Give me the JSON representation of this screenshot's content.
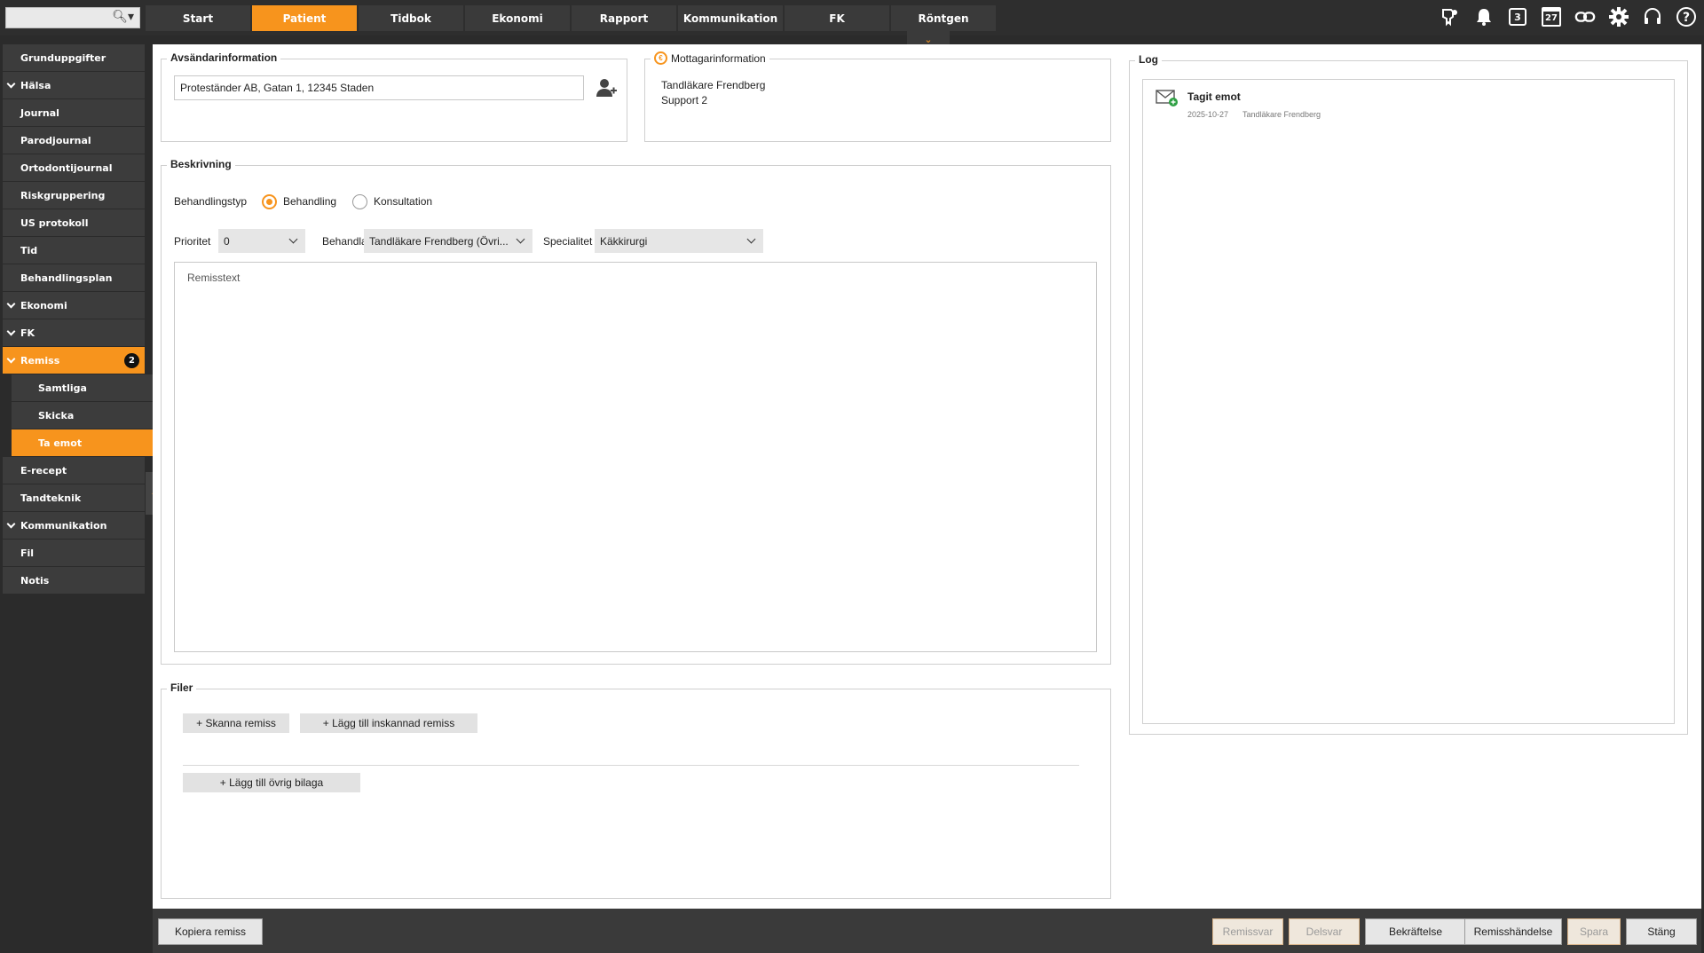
{
  "search": {
    "placeholder": ""
  },
  "tabs": [
    {
      "label": "Start"
    },
    {
      "label": "Patient"
    },
    {
      "label": "Tidbok"
    },
    {
      "label": "Ekonomi"
    },
    {
      "label": "Rapport"
    },
    {
      "label": "Kommunikation"
    },
    {
      "label": "FK"
    },
    {
      "label": "Röntgen"
    }
  ],
  "top_icons": {
    "notification_count": "3",
    "calendar_day": "27",
    "icons": [
      "tooth-book-icon",
      "bell-icon",
      "counter-icon",
      "calendar-icon",
      "link-icon",
      "gear-icon",
      "headset-icon",
      "help-icon"
    ]
  },
  "sidebar": {
    "items": [
      {
        "label": "Grunduppgifter"
      },
      {
        "label": "Hälsa"
      },
      {
        "label": "Journal"
      },
      {
        "label": "Parodjournal"
      },
      {
        "label": "Ortodontijournal"
      },
      {
        "label": "Riskgruppering"
      },
      {
        "label": "US protokoll"
      },
      {
        "label": "Tid"
      },
      {
        "label": "Behandlingsplan"
      },
      {
        "label": "Ekonomi"
      },
      {
        "label": "FK"
      },
      {
        "label": "Remiss",
        "count": "2"
      },
      {
        "label": "Samtliga"
      },
      {
        "label": "Skicka"
      },
      {
        "label": "Ta emot"
      },
      {
        "label": "E-recept"
      },
      {
        "label": "Tandteknik"
      },
      {
        "label": "Kommunikation"
      },
      {
        "label": "Fil"
      },
      {
        "label": "Notis"
      }
    ]
  },
  "sender": {
    "title": "Avsändarinformation",
    "address": "Proteständer AB, Gatan 1, 12345 Staden"
  },
  "receiver": {
    "title": "Mottagarinformation",
    "line1": "Tandläkare Frendberg",
    "line2": "Support 2"
  },
  "description": {
    "title": "Beskrivning",
    "type_label": "Behandlingstyp",
    "option_treatment": "Behandling",
    "option_consultation": "Konsultation",
    "selected_type": "Behandling",
    "priority_label": "Prioritet",
    "priority_value": "0",
    "handler_label": "Behandla",
    "handler_value": "Tandläkare Frendberg (Övri...",
    "specialty_label": "Specialitet",
    "specialty_value": "Käkkirurgi",
    "referral_placeholder": "Remisstext"
  },
  "files": {
    "title": "Filer",
    "scan_button": "+ Skanna remiss",
    "add_scanned_button": "+ Lägg till inskannad remiss",
    "add_other_button": "+ Lägg till övrig bilaga"
  },
  "log": {
    "title": "Log",
    "entries": [
      {
        "title": "Tagit emot",
        "date": "2025-10-27",
        "user": "Tandläkare Frendberg"
      }
    ]
  },
  "footer": {
    "copy_button": "Kopiera remiss",
    "reply_button": "Remissvar",
    "partial_reply_button": "Delsvar",
    "confirm_button": "Bekräftelse",
    "event_button": "Remisshändelse",
    "save_button": "Spara",
    "close_button": "Stäng"
  }
}
